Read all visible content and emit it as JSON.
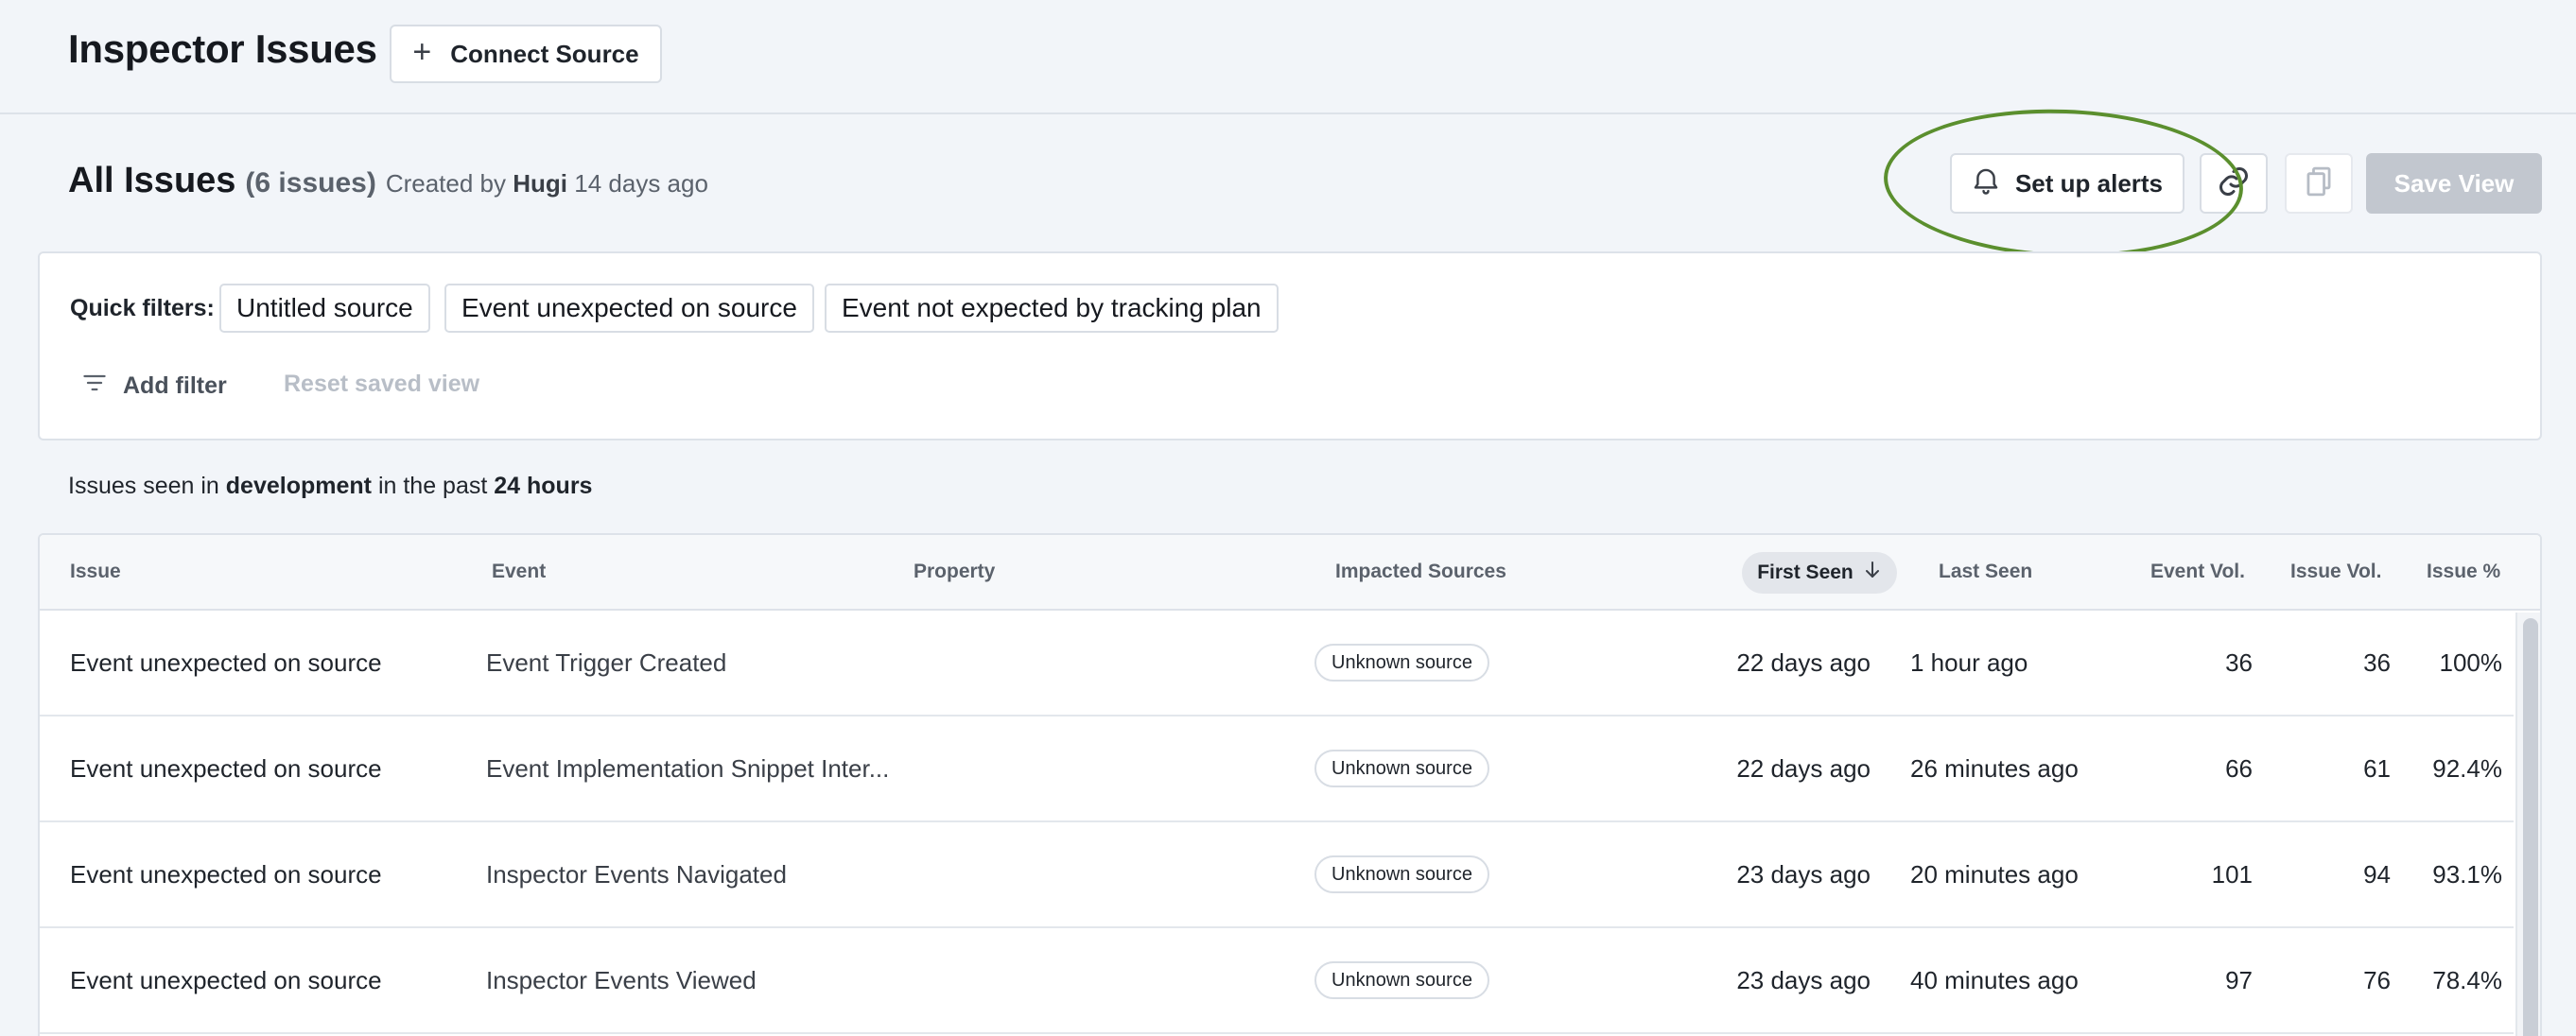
{
  "header": {
    "title": "Inspector Issues",
    "connect_source_label": "Connect Source"
  },
  "view": {
    "title": "All Issues",
    "count": "(6 issues)",
    "created_prefix": "Created by",
    "creator": "Hugi",
    "created_ago": "14 days ago",
    "set_up_alerts_label": "Set up alerts",
    "save_view_label": "Save View"
  },
  "filters": {
    "quick_label": "Quick filters:",
    "chips": [
      "Untitled source",
      "Event unexpected on source",
      "Event not expected by tracking plan"
    ],
    "add_filter_label": "Add filter",
    "reset_label": "Reset saved view"
  },
  "summary": {
    "prefix": "Issues seen in",
    "environment": "development",
    "middle": "in the past",
    "period": "24 hours"
  },
  "table": {
    "columns": {
      "issue": "Issue",
      "event": "Event",
      "property": "Property",
      "impacted_sources": "Impacted Sources",
      "first_seen": "First Seen",
      "last_seen": "Last Seen",
      "event_vol": "Event Vol.",
      "issue_vol": "Issue Vol.",
      "issue_pct": "Issue %"
    },
    "rows": [
      {
        "issue": "Event unexpected on source",
        "event": "Event Trigger Created",
        "property": "",
        "source": "Unknown source",
        "first_seen": "22 days ago",
        "last_seen": "1 hour ago",
        "event_vol": "36",
        "issue_vol": "36",
        "issue_pct": "100%"
      },
      {
        "issue": "Event unexpected on source",
        "event": "Event Implementation Snippet Inter...",
        "property": "",
        "source": "Unknown source",
        "first_seen": "22 days ago",
        "last_seen": "26 minutes ago",
        "event_vol": "66",
        "issue_vol": "61",
        "issue_pct": "92.4%"
      },
      {
        "issue": "Event unexpected on source",
        "event": "Inspector Events Navigated",
        "property": "",
        "source": "Unknown source",
        "first_seen": "23 days ago",
        "last_seen": "20 minutes ago",
        "event_vol": "101",
        "issue_vol": "94",
        "issue_pct": "93.1%"
      },
      {
        "issue": "Event unexpected on source",
        "event": "Inspector Events Viewed",
        "property": "",
        "source": "Unknown source",
        "first_seen": "23 days ago",
        "last_seen": "40 minutes ago",
        "event_vol": "97",
        "issue_vol": "76",
        "issue_pct": "78.4%"
      }
    ]
  },
  "colors": {
    "highlight": "#5b8f2e",
    "save_disabled": "#c2c7cf"
  }
}
